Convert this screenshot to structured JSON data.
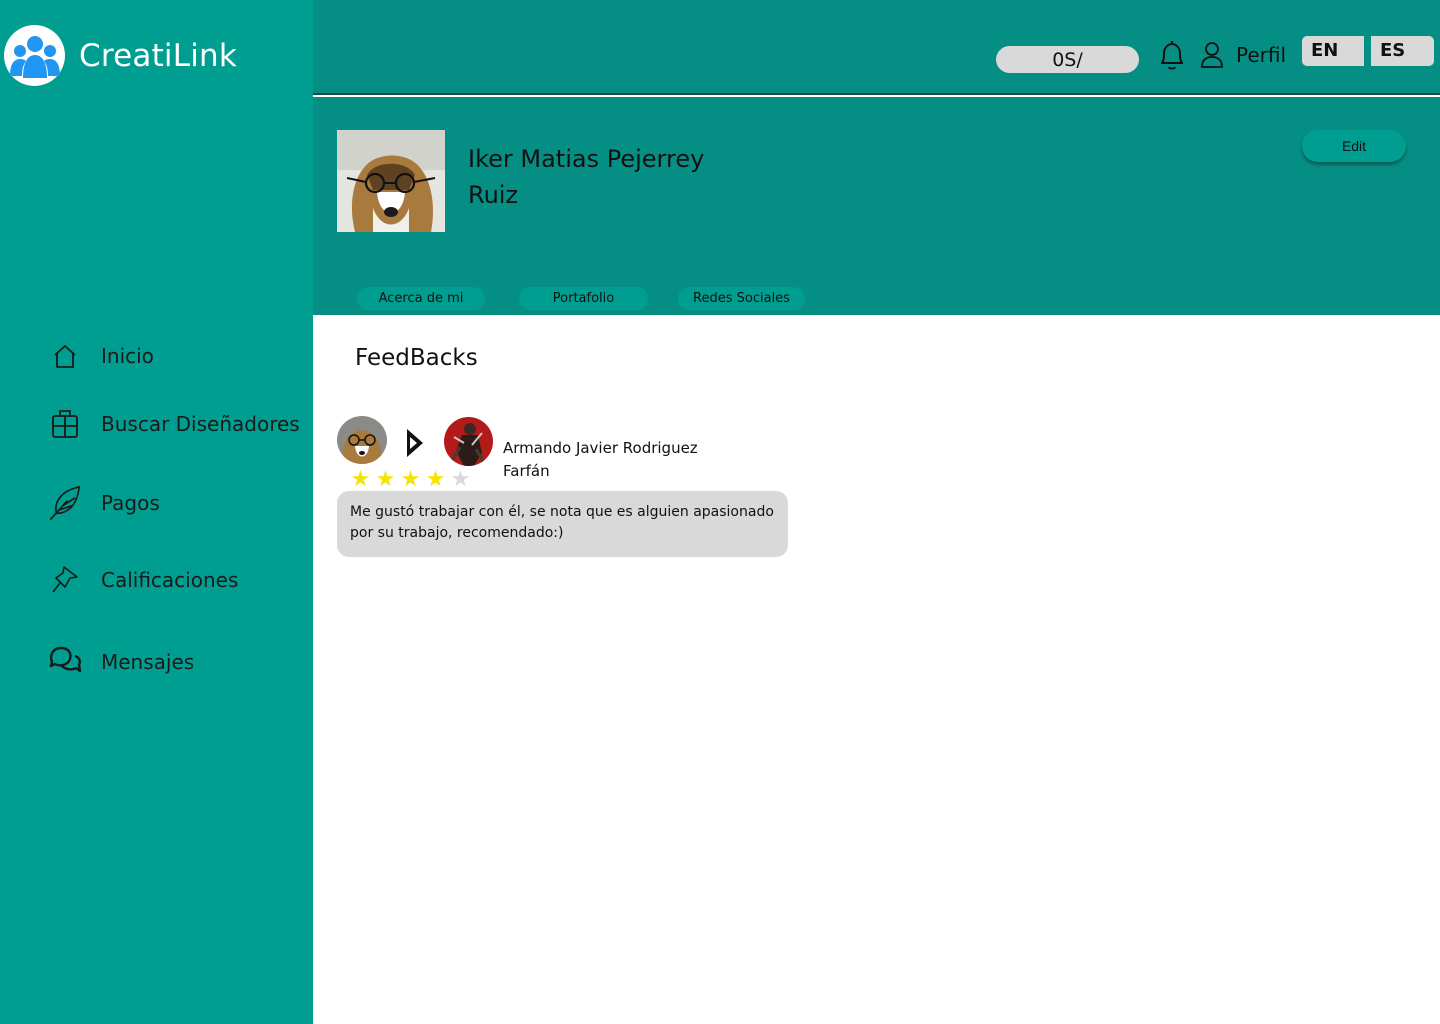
{
  "brand": {
    "name": "CreatiLink",
    "icon": "users-group-icon"
  },
  "nav": {
    "items": [
      {
        "label": "Inicio",
        "icon": "home-icon"
      },
      {
        "label": "Buscar Diseñadores",
        "icon": "grid-box-icon"
      },
      {
        "label": "Pagos",
        "icon": "feather-icon"
      },
      {
        "label": "Calificaciones",
        "icon": "pin-icon"
      },
      {
        "label": "Mensajes",
        "icon": "chat-bubbles-icon"
      }
    ]
  },
  "topbar": {
    "balance": "0S/",
    "profile_label": "Perfil",
    "languages": [
      "EN",
      "ES"
    ]
  },
  "profile": {
    "name_line1": "Iker Matias Pejerrey",
    "name_line2": "Ruiz",
    "edit_label": "Edit",
    "tabs": [
      "Acerca de mi",
      "Portafolio",
      "Redes Sociales"
    ]
  },
  "feedbacks": {
    "title": "FeedBacks",
    "items": [
      {
        "reviewer_line1": "Armando Javier Rodriguez",
        "reviewer_line2": "Farfán",
        "rating": 4,
        "max_rating": 5,
        "comment": "Me gustó trabajar con él, se nota que es alguien apasionado por su trabajo, recomendado:)"
      }
    ]
  },
  "colors": {
    "sidebar": "#009e91",
    "header": "#058f84",
    "star_filled": "#f2e600",
    "star_empty": "#d9d9d9"
  }
}
